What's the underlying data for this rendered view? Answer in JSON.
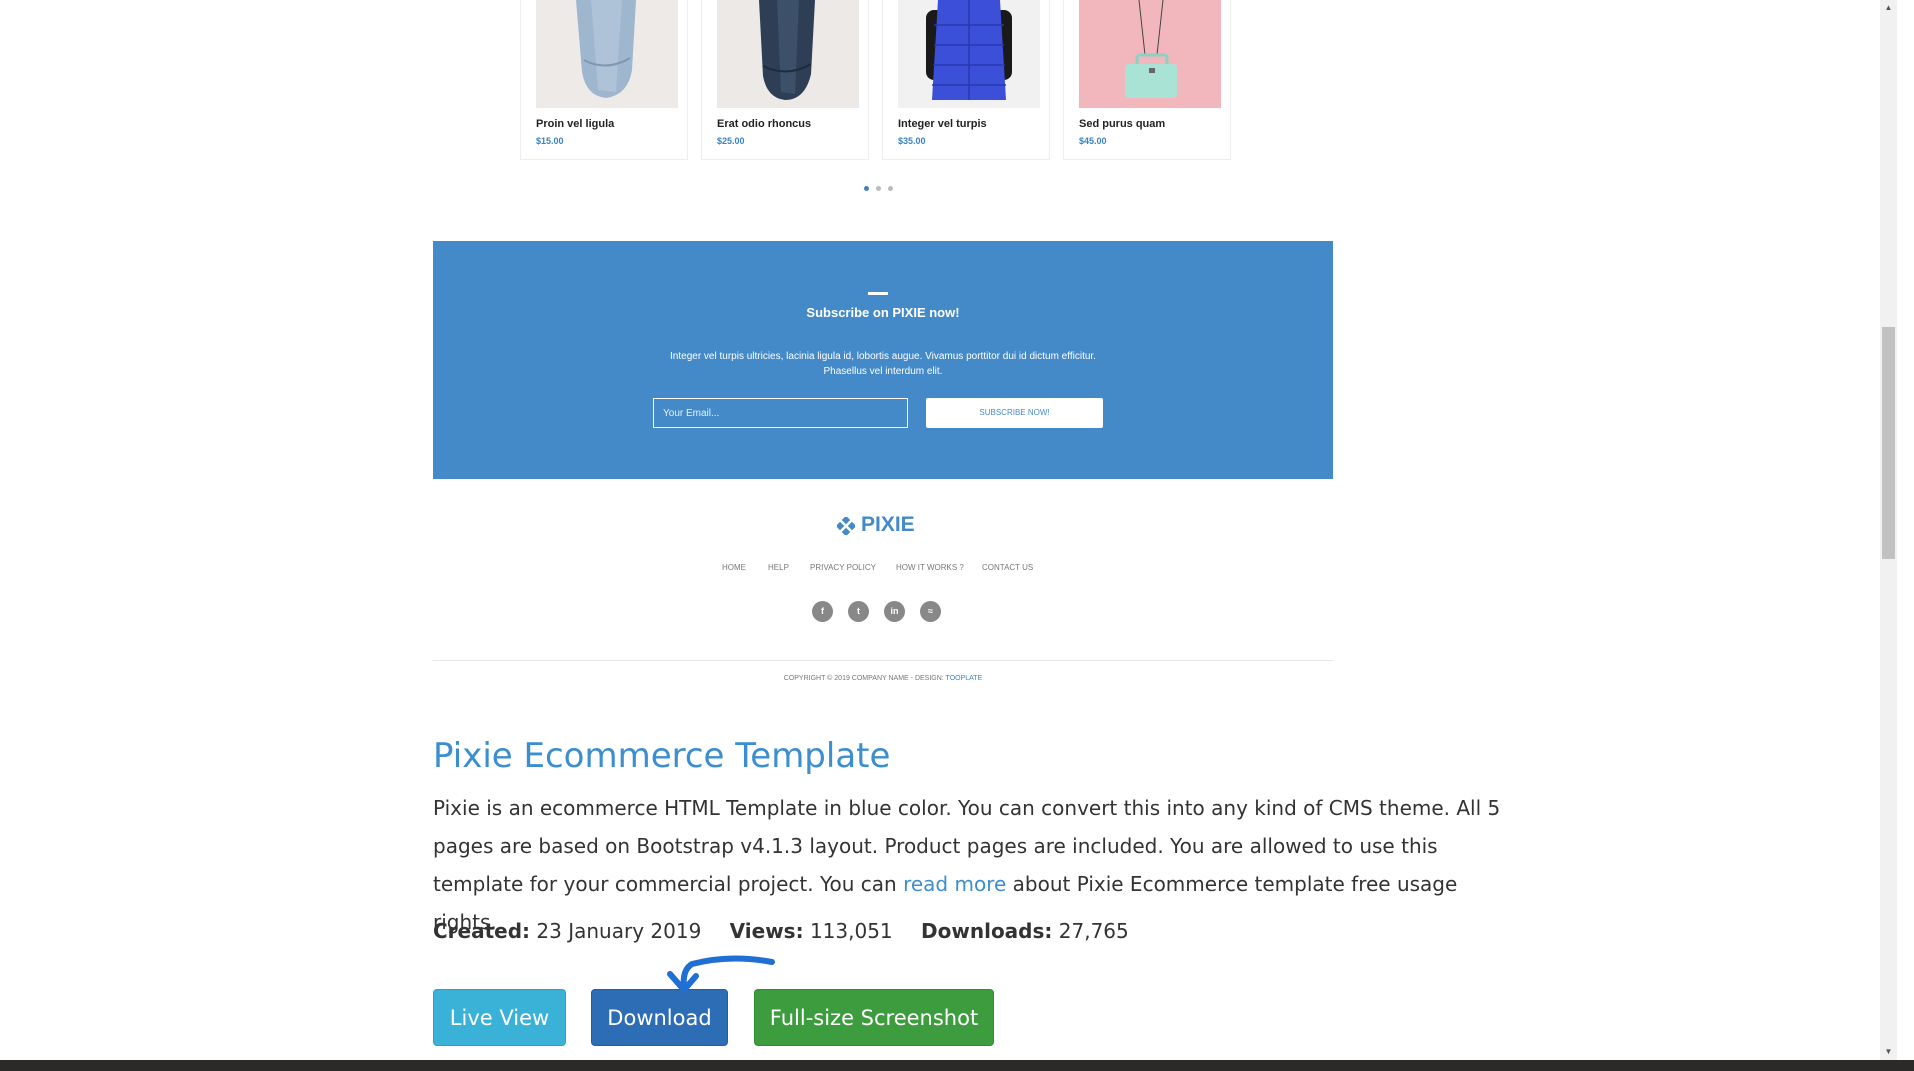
{
  "products": [
    {
      "name": "Proin vel ligula",
      "price": "$15.00",
      "image": "light-jeans"
    },
    {
      "name": "Erat odio rhoncus",
      "price": "$25.00",
      "image": "dark-jeans"
    },
    {
      "name": "Integer vel turpis",
      "price": "$35.00",
      "image": "blue-vest"
    },
    {
      "name": "Sed purus quam",
      "price": "$45.00",
      "image": "mint-bag"
    }
  ],
  "subscribe": {
    "title": "Subscribe on PIXIE now!",
    "text": "Integer vel turpis ultricies, lacinia ligula id, lobortis augue. Vivamus porttitor dui id dictum efficitur. Phasellus vel interdum elit.",
    "placeholder": "Your Email...",
    "button": "SUBSCRIBE NOW!",
    "color": "#448ac9"
  },
  "brand": "PIXIE",
  "footer_nav": [
    "HOME",
    "HELP",
    "PRIVACY POLICY",
    "HOW IT WORKS ?",
    "CONTACT US"
  ],
  "socials": [
    {
      "icon": "facebook-icon",
      "glyph": "f"
    },
    {
      "icon": "twitter-icon",
      "glyph": "t"
    },
    {
      "icon": "linkedin-icon",
      "glyph": "in"
    },
    {
      "icon": "rss-icon",
      "glyph": "≈"
    }
  ],
  "copyright": {
    "text": "COPYRIGHT © 2019 COMPANY NAME - DESIGN: ",
    "link": "TOOPLATE"
  },
  "template": {
    "title": "Pixie Ecommerce Template",
    "desc_before": "Pixie is an ecommerce HTML Template in blue color. You can convert this into any kind of CMS theme. All 5 pages are based on Bootstrap v4.1.3 layout. Product pages are included. You are allowed to use this template for your commercial project. You can ",
    "desc_link": "read more",
    "desc_after": " about Pixie Ecommerce template free usage rights."
  },
  "meta": {
    "created_label": "Created:",
    "created": "23 January 2019",
    "views_label": "Views:",
    "views": "113,051",
    "downloads_label": "Downloads:",
    "downloads": "27,765"
  },
  "buttons": {
    "live": "Live View",
    "download": "Download",
    "screenshot": "Full-size Screenshot"
  },
  "colors": {
    "accent": "#3b8ed0",
    "live": "#3ab2d8",
    "download": "#2d6db5",
    "screenshot": "#3d9d3e",
    "annotation": "#1f6fd4"
  }
}
